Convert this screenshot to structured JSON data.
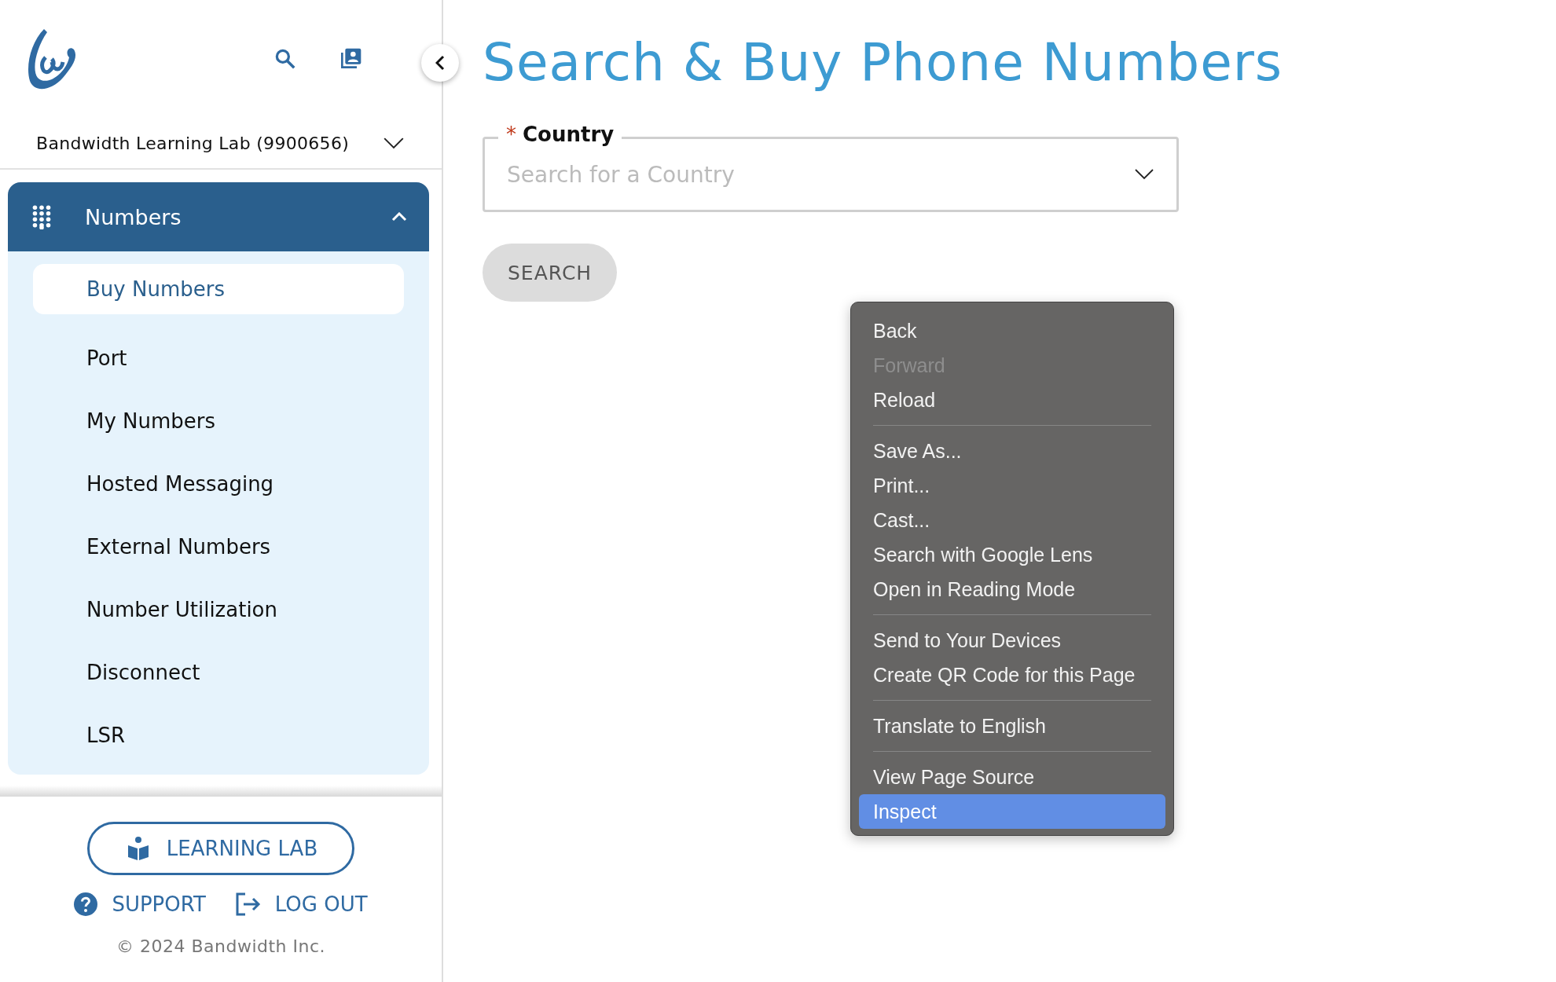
{
  "sidebar": {
    "account": "Bandwidth Learning Lab (9900656)",
    "section": {
      "label": "Numbers",
      "expanded": true,
      "items": [
        {
          "label": "Buy Numbers",
          "selected": true
        },
        {
          "label": "Port",
          "selected": false
        },
        {
          "label": "My Numbers",
          "selected": false
        },
        {
          "label": "Hosted Messaging",
          "selected": false
        },
        {
          "label": "External Numbers",
          "selected": false
        },
        {
          "label": "Number Utilization",
          "selected": false
        },
        {
          "label": "Disconnect",
          "selected": false
        },
        {
          "label": "LSR",
          "selected": false
        }
      ]
    },
    "learning_lab": "LEARNING LAB",
    "support": "SUPPORT",
    "logout": "LOG OUT",
    "copyright": "© 2024 Bandwidth Inc."
  },
  "page": {
    "title": "Search & Buy Phone Numbers",
    "country_field": {
      "required_mark": "*",
      "label": "Country",
      "placeholder": "Search for a Country"
    },
    "search_button": "SEARCH"
  },
  "context_menu": {
    "groups": [
      [
        {
          "label": "Back",
          "disabled": false,
          "selected": false
        },
        {
          "label": "Forward",
          "disabled": true,
          "selected": false
        },
        {
          "label": "Reload",
          "disabled": false,
          "selected": false
        }
      ],
      [
        {
          "label": "Save As...",
          "disabled": false,
          "selected": false
        },
        {
          "label": "Print...",
          "disabled": false,
          "selected": false
        },
        {
          "label": "Cast...",
          "disabled": false,
          "selected": false
        },
        {
          "label": "Search with Google Lens",
          "disabled": false,
          "selected": false
        },
        {
          "label": "Open in Reading Mode",
          "disabled": false,
          "selected": false
        }
      ],
      [
        {
          "label": "Send to Your Devices",
          "disabled": false,
          "selected": false
        },
        {
          "label": "Create QR Code for this Page",
          "disabled": false,
          "selected": false
        }
      ],
      [
        {
          "label": "Translate to English",
          "disabled": false,
          "selected": false
        }
      ],
      [
        {
          "label": "View Page Source",
          "disabled": false,
          "selected": false
        },
        {
          "label": "Inspect",
          "disabled": false,
          "selected": true
        }
      ]
    ]
  }
}
